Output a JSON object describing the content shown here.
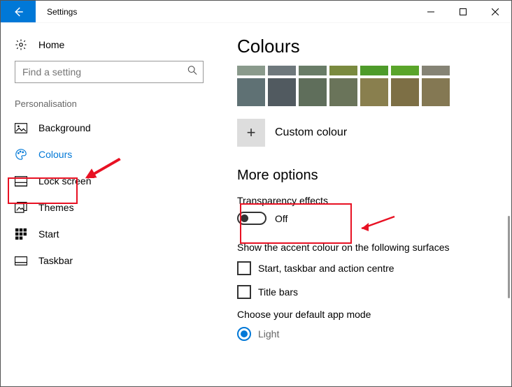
{
  "window": {
    "title": "Settings"
  },
  "sidebar": {
    "home_label": "Home",
    "search_placeholder": "Find a setting",
    "section_label": "Personalisation",
    "items": [
      {
        "label": "Background"
      },
      {
        "label": "Colours"
      },
      {
        "label": "Lock screen"
      },
      {
        "label": "Themes"
      },
      {
        "label": "Start"
      },
      {
        "label": "Taskbar"
      }
    ]
  },
  "main": {
    "page_title": "Colours",
    "swatch_colors_top": [
      "#8a9a8c",
      "#6e787c",
      "#697c67",
      "#7a8a3f",
      "#4e9b2a",
      "#5aa52a",
      "#858375"
    ],
    "swatch_colors": [
      "#5f7174",
      "#515a60",
      "#5f6e5b",
      "#6a745a",
      "#897f4e",
      "#7d6f45",
      "#847853"
    ],
    "custom_label": "Custom colour",
    "more_options": "More options",
    "transparency_label": "Transparency effects",
    "transparency_state": "Off",
    "surfaces_label": "Show the accent colour on the following surfaces",
    "check1": "Start, taskbar and action centre",
    "check2": "Title bars",
    "mode_label": "Choose your default app mode",
    "mode_option": "Light"
  }
}
